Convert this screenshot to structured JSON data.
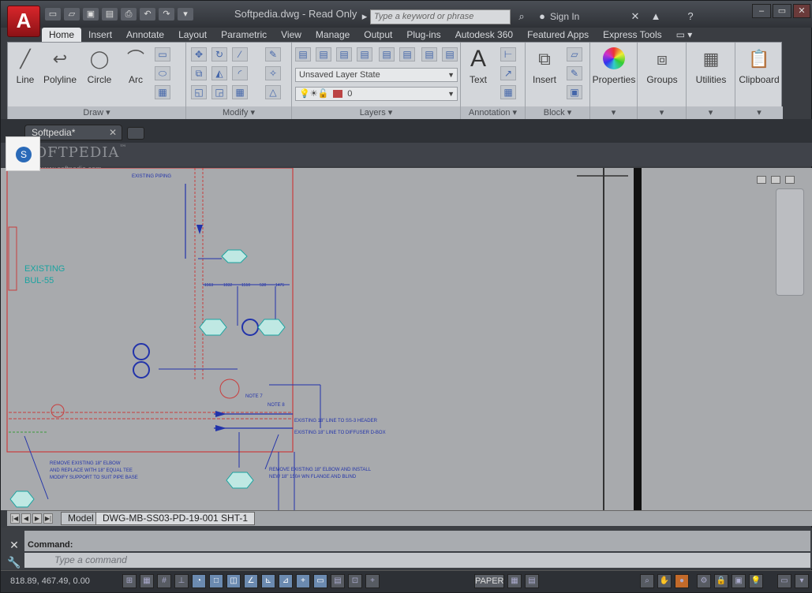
{
  "window": {
    "title": "Softpedia.dwg - Read Only",
    "app_logo": "A"
  },
  "search": {
    "placeholder": "Type a keyword or phrase"
  },
  "account": {
    "sign_in": "Sign In"
  },
  "ribbon_tabs": [
    "Home",
    "Insert",
    "Annotate",
    "Layout",
    "Parametric",
    "View",
    "Manage",
    "Output",
    "Plug-ins",
    "Autodesk 360",
    "Featured Apps",
    "Express Tools"
  ],
  "ribbon": {
    "draw": {
      "title": "Draw",
      "line": "Line",
      "polyline": "Polyline",
      "circle": "Circle",
      "arc": "Arc"
    },
    "modify": {
      "title": "Modify"
    },
    "layers": {
      "title": "Layers",
      "layer_state": "Unsaved Layer State",
      "current_layer": "0"
    },
    "annotation": {
      "title": "Annotation",
      "text": "Text"
    },
    "block": {
      "title": "Block",
      "insert": "Insert"
    },
    "properties": {
      "label": "Properties"
    },
    "groups": {
      "label": "Groups"
    },
    "utilities": {
      "label": "Utilities"
    },
    "clipboard": {
      "label": "Clipboard"
    }
  },
  "file_tab": {
    "name": "Softpedia*"
  },
  "watermark": {
    "text": "SOFTPEDIA",
    "trademark": "™",
    "url": "www.softpedia.com"
  },
  "drawing": {
    "labels": {
      "existing_piping": "EXISTING PIPING",
      "existing_bul": "EXISTING",
      "existing_bul_2": "BUL-55",
      "note7": "NOTE 7",
      "note8": "NOTE 8",
      "line_ss2": "EXISTING 18\" LINE TO SS-3 HEADER",
      "line_diffuser": "EXISTING 18\" LINE TO DIFFUSER D-BOX",
      "remove_elbow_1": "REMOVE EXISTING 18\" ELBOW",
      "remove_elbow_2": "AND REPLACE WITH 18\" EQUAL TEE",
      "remove_elbow_3": "MODIFY SUPPORT TO SUIT PIPE BASE",
      "remove_install_1": "REMOVE EXISTING 18\" ELBOW AND INSTALL",
      "remove_install_2": "NEW 18\" 150# WN FLANGE AND BLIND",
      "dims": [
        "1563",
        "1032",
        "1510",
        "530",
        "1475"
      ]
    }
  },
  "layout_tabs": {
    "model": "Model",
    "sheet": "DWG-MB-SS03-PD-19-001 SHT-1"
  },
  "command": {
    "label": "Command:",
    "placeholder": "Type a command"
  },
  "status": {
    "coords": "818.89, 467.49, 0.00",
    "paper": "PAPER"
  }
}
